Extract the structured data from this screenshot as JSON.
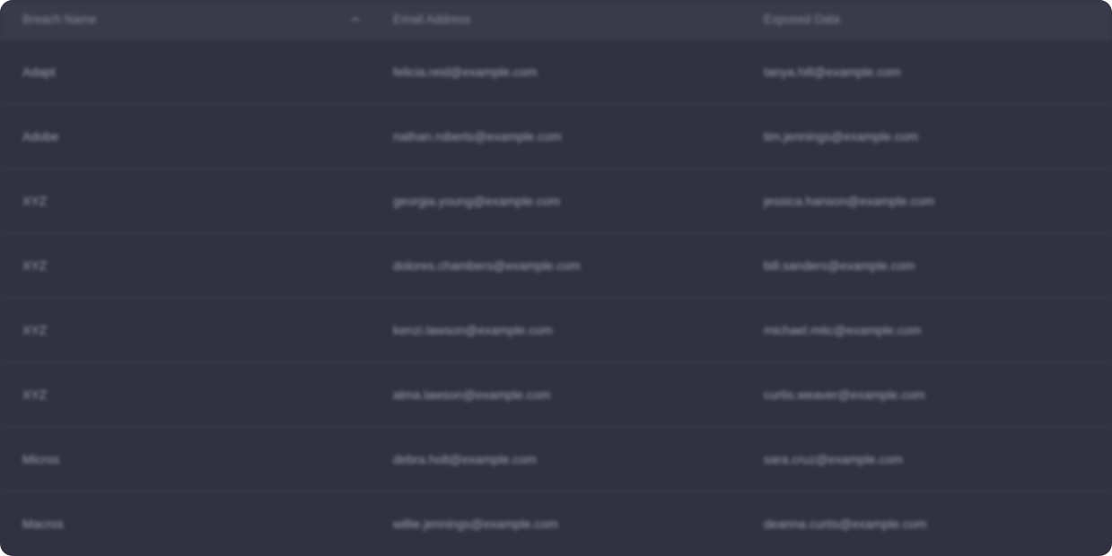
{
  "table": {
    "columns": [
      {
        "label": "Breach Name",
        "sorted": "ascending"
      },
      {
        "label": "Email Address"
      },
      {
        "label": "Exposed Data"
      }
    ],
    "rows": [
      {
        "breach": "Adapt",
        "email": "felicia.reid@example.com",
        "exposed": "tanya.hill@example.com"
      },
      {
        "breach": "Adobe",
        "email": "nathan.roberts@example.com",
        "exposed": "tim.jennings@example.com"
      },
      {
        "breach": "XYZ",
        "email": "georgia.young@example.com",
        "exposed": "jessica.hanson@example.com"
      },
      {
        "breach": "XYZ",
        "email": "dolores.chambers@example.com",
        "exposed": "bill.sanders@example.com"
      },
      {
        "breach": "XYZ",
        "email": "kenzi.lawson@example.com",
        "exposed": "michael.mitc@example.com"
      },
      {
        "breach": "XYZ",
        "email": "alma.lawson@example.com",
        "exposed": "curtis.weaver@example.com"
      },
      {
        "breach": "Micros",
        "email": "debra.holt@example.com",
        "exposed": "sara.cruz@example.com"
      },
      {
        "breach": "Macros",
        "email": "willie.jennings@example.com",
        "exposed": "deanna.curtis@example.com"
      }
    ]
  },
  "icons": {
    "sort": "chevron-up-icon"
  },
  "colors": {
    "background": "#31313f",
    "header_background": "#3a3a4a",
    "text": "#a4a4b4",
    "header_text": "#8d8da0"
  }
}
